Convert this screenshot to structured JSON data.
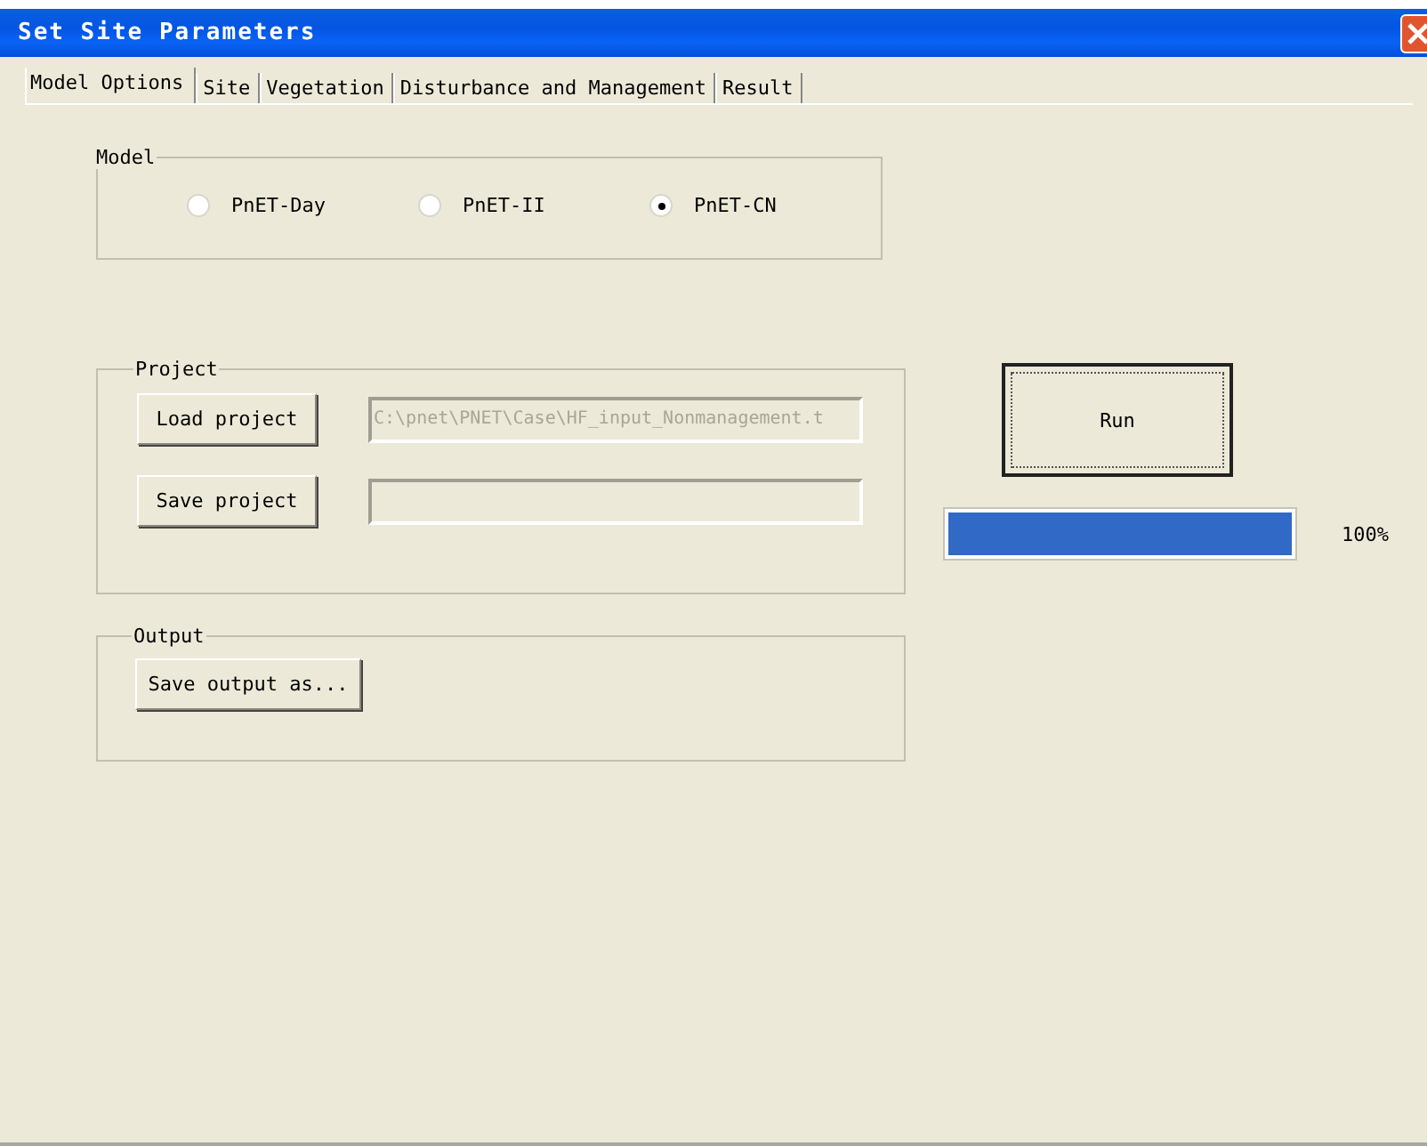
{
  "window": {
    "title": "Set Site Parameters"
  },
  "tabs": [
    {
      "label": "Model Options",
      "selected": true
    },
    {
      "label": "Site",
      "selected": false
    },
    {
      "label": "Vegetation",
      "selected": false
    },
    {
      "label": "Disturbance and Management",
      "selected": false
    },
    {
      "label": "Result",
      "selected": false
    }
  ],
  "model": {
    "legend": "Model",
    "options": [
      {
        "label": "PnET-Day",
        "selected": false
      },
      {
        "label": "PnET-II",
        "selected": false
      },
      {
        "label": "PnET-CN",
        "selected": true
      }
    ]
  },
  "project": {
    "legend": "Project",
    "load_button": "Load project",
    "load_path": {
      "value": "C:\\pnet\\PNET\\Case\\HF_input_Nonmanagement.t",
      "disabled": true
    },
    "save_button": "Save project"
  },
  "output": {
    "legend": "Output",
    "save_button": "Save output as..."
  },
  "run": {
    "button": "Run",
    "progress": {
      "level": 1.0,
      "reading": "100%"
    }
  }
}
